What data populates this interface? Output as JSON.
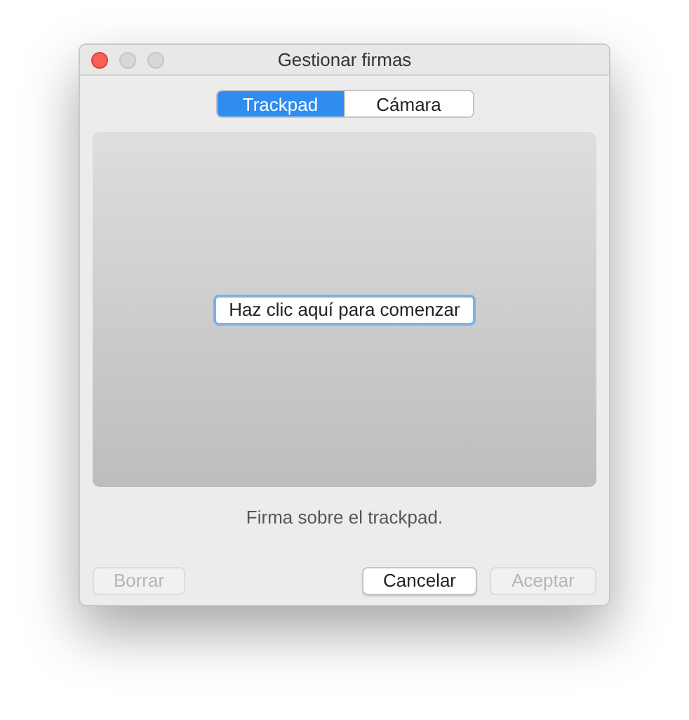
{
  "window": {
    "title": "Gestionar firmas"
  },
  "tabs": [
    {
      "label": "Trackpad",
      "selected": true
    },
    {
      "label": "Cámara",
      "selected": false
    }
  ],
  "canvas": {
    "button": "Haz clic aquí para comenzar"
  },
  "caption": "Firma sobre el trackpad.",
  "buttons": [
    {
      "label": "Borrar",
      "disabled": true
    },
    {
      "label": "Cancelar",
      "disabled": false
    },
    {
      "label": "Aceptar",
      "disabled": true
    }
  ]
}
